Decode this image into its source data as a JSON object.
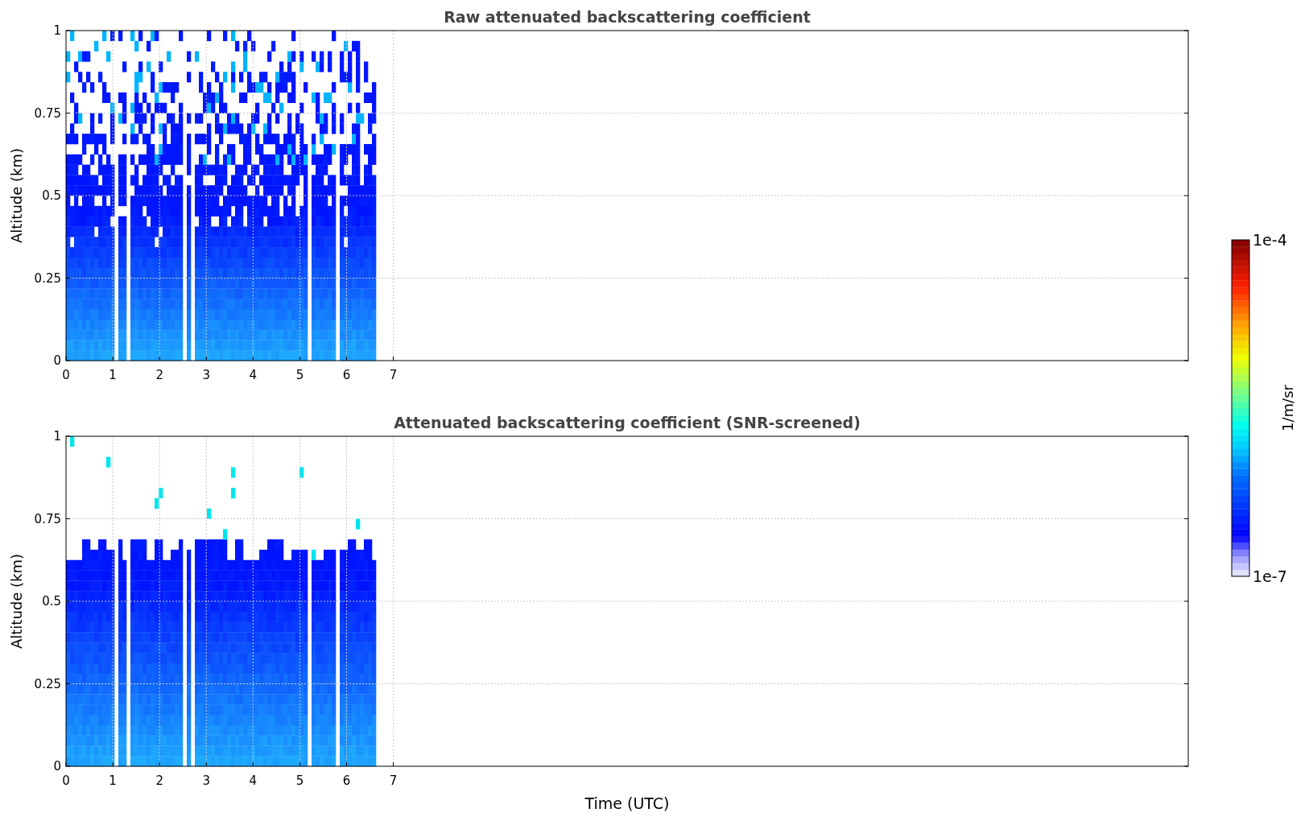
{
  "panels": [
    {
      "kind": "raw",
      "title": "Raw attenuated backscattering coefficient",
      "ylabel": "Altitude (km)",
      "yticks": [
        "1",
        "0.75",
        "0.5",
        "0.25",
        "0"
      ],
      "xticks": [
        "0",
        "1",
        "2",
        "3",
        "4",
        "5",
        "6",
        "7"
      ]
    },
    {
      "kind": "screened",
      "title": "Attenuated backscattering coefficient (SNR-screened)",
      "ylabel": "Altitude (km)",
      "yticks": [
        "1",
        "0.75",
        "0.5",
        "0.25",
        "0"
      ],
      "xticks": [
        "0",
        "1",
        "2",
        "3",
        "4",
        "5",
        "6",
        "7"
      ]
    }
  ],
  "xlabel": "Time (UTC)",
  "colorbar": {
    "label": "1/m/sr",
    "max_label": "1e-4",
    "min_label": "1e-7"
  }
}
